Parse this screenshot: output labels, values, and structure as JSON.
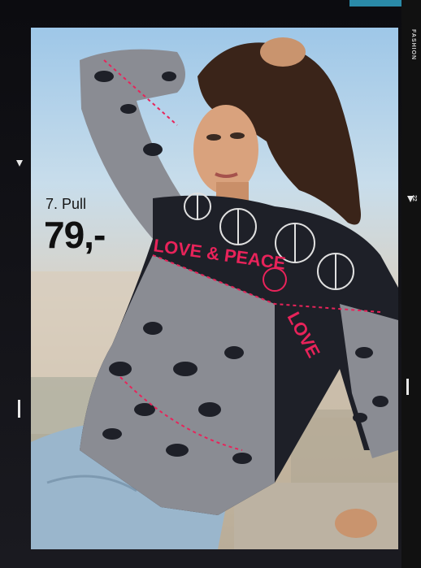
{
  "side": {
    "label": "FASHION",
    "page": "22"
  },
  "product": {
    "label": "7. Pull",
    "price": "79,-"
  },
  "sweater_text": {
    "line1": "LOVE & PEACE",
    "line2": "LOVE"
  },
  "colors": {
    "accent_red": "#e8235a",
    "sweater_dark": "#1e2028",
    "sweater_grey": "#8a8c93",
    "jeans": "#9ab6cc"
  }
}
